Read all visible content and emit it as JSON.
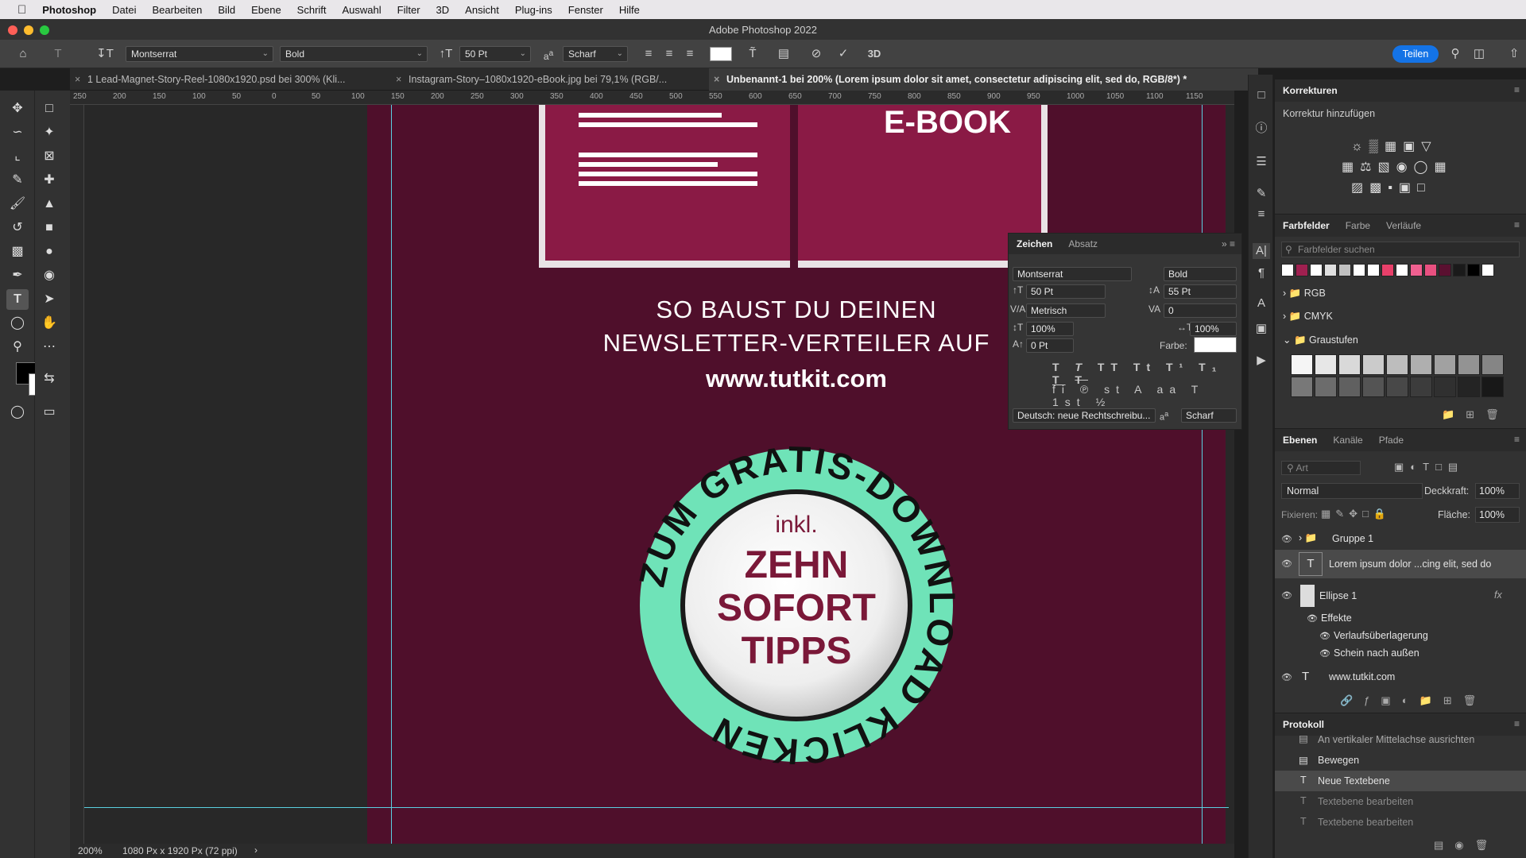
{
  "menubar": {
    "app": "Photoshop",
    "items": [
      "Datei",
      "Bearbeiten",
      "Bild",
      "Ebene",
      "Schrift",
      "Auswahl",
      "Filter",
      "3D",
      "Ansicht",
      "Plug-ins",
      "Fenster",
      "Hilfe"
    ]
  },
  "window": {
    "title": "Adobe Photoshop 2022"
  },
  "options": {
    "font_family": "Montserrat",
    "font_style": "Bold",
    "font_size": "50 Pt",
    "aa_label": "a",
    "antialias": "Scharf",
    "share_label": "Teilen",
    "text_color": "#ffffff"
  },
  "tabs": [
    {
      "label": "1 Lead-Magnet-Story-Reel-1080x1920.psd bei 300% (Kli..."
    },
    {
      "label": "Instagram-Story–1080x1920-eBook.jpg bei 79,1% (RGB/..."
    },
    {
      "label": "Unbenannt-1 bei 200% (Lorem ipsum dolor sit amet, consectetur adipiscing elit, sed do, RGB/8*) *",
      "active": true
    }
  ],
  "ruler": {
    "ticks": [
      "250",
      "200",
      "150",
      "100",
      "50",
      "0",
      "50",
      "100",
      "150",
      "200",
      "250",
      "300",
      "350",
      "400",
      "450",
      "500",
      "550",
      "600",
      "650",
      "700",
      "750",
      "800",
      "850",
      "900",
      "950",
      "1000",
      "1050",
      "1100",
      "1150"
    ]
  },
  "canvas": {
    "ebook_title": "E-BOOK",
    "headline_line1": "SO BAUST DU DEINEN",
    "headline_line2": "NEWSLETTER-VERTEILER AUF",
    "url": "www.tutkit.com",
    "badge_ring_text": "ZUM GRATIS-DOWNLOAD KLICKEN",
    "badge_small": "inkl.",
    "badge_line1": "ZEHN",
    "badge_line2": "SOFORT",
    "badge_line3": "TIPPS",
    "colors": {
      "bg": "#4f0f2b",
      "book": "#8a1a45",
      "ring": "#6fe3b8",
      "badge_text": "#7a1838"
    }
  },
  "status": {
    "zoom": "200%",
    "doc_size": "1080 Px x 1920 Px (72 ppi)"
  },
  "korrekturen": {
    "tab": "Korrekturen",
    "subtitle": "Korrektur hinzufügen"
  },
  "farbfelder": {
    "tabs": [
      "Farbfelder",
      "Farbe",
      "Verläufe"
    ],
    "search_placeholder": "Farbfelder suchen",
    "swatches": [
      "#ffffff",
      "#a02050",
      "#ffffff",
      "#e0e0e0",
      "#c0c0c0",
      "#ffffff",
      "#ffffff",
      "#e8406a",
      "#ffffff",
      "#f06090",
      "#e85080",
      "#5a1030",
      "#1a1a1a",
      "#000000",
      "#ffffff"
    ],
    "groups": [
      "RGB",
      "CMYK",
      "Graustufen"
    ]
  },
  "zeichen": {
    "tabs": [
      "Zeichen",
      "Absatz"
    ],
    "font": "Montserrat",
    "style": "Bold",
    "size": "50 Pt",
    "leading": "55 Pt",
    "kerning": "Metrisch",
    "tracking": "0",
    "vscale": "100%",
    "hscale": "100%",
    "baseline": "0 Pt",
    "color_label": "Farbe:",
    "language": "Deutsch: neue Rechtschreibu...",
    "aa_label": "a",
    "antialias": "Scharf"
  },
  "ebenen": {
    "tabs": [
      "Ebenen",
      "Kanäle",
      "Pfade"
    ],
    "filter_placeholder": "Art",
    "blend": "Normal",
    "opacity_label": "Deckkraft:",
    "opacity": "100%",
    "lock_label": "Fixieren:",
    "fill_label": "Fläche:",
    "fill": "100%",
    "layers": [
      "Gruppe 1",
      "Lorem ipsum dolor ...cing elit, sed do",
      "Ellipse 1",
      "Effekte",
      "Verlaufsüberlagerung",
      "Schein nach außen",
      "www.tutkit.com"
    ],
    "fx_label": "fx"
  },
  "protokoll": {
    "tab": "Protokoll",
    "items": [
      "An vertikaler Mittelachse ausrichten",
      "Bewegen",
      "Neue Textebene",
      "Textebene bearbeiten",
      "Textebene bearbeiten"
    ]
  }
}
